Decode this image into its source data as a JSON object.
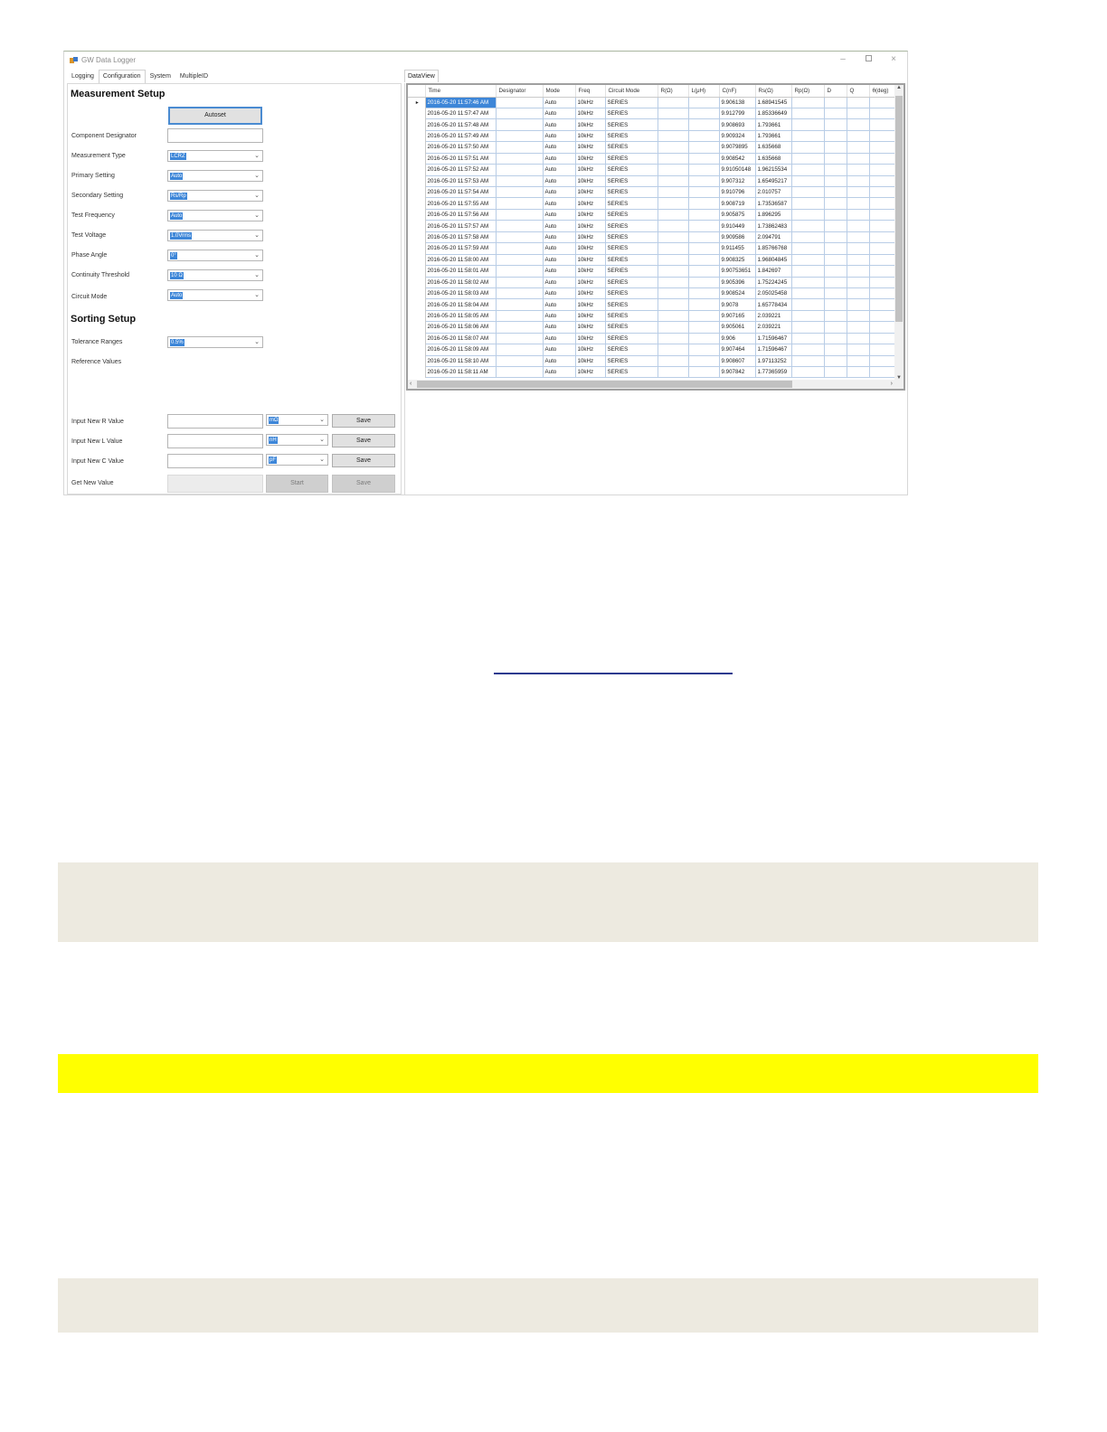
{
  "window": {
    "title": "GW Data Logger",
    "controls": [
      "–",
      "×"
    ]
  },
  "left_tabs": [
    "Logging",
    "Configuration",
    "System",
    "MultipleID"
  ],
  "active_tab": "Configuration",
  "measurement_setup": {
    "title": "Measurement Setup",
    "autoset_label": "Autoset",
    "labels": {
      "component_designator": "Component Designator",
      "measurement_type": "Measurement Type",
      "primary_setting": "Primary Setting",
      "secondary_setting": "Secondary Setting",
      "test_frequency": "Test Frequency",
      "test_voltage": "Test Voltage",
      "phase_angle": "Phase Angle",
      "continuity_threshold": "Continuity Threshold",
      "circuit_mode": "Circuit Mode"
    },
    "values": {
      "measurement_type": "LCRZ",
      "primary_setting": "Auto",
      "secondary_setting": "Rs/Rp",
      "test_frequency": "Auto",
      "test_voltage": "1.0Vrms",
      "phase_angle": "0°",
      "continuity_threshold": "10 Ω",
      "circuit_mode": "Auto"
    }
  },
  "sorting_setup": {
    "title": "Sorting Setup",
    "tolerance_label": "Tolerance Ranges",
    "tolerance_value": "0.5%",
    "reference_label": "Reference Values",
    "input_r_label": "Input New R Value",
    "input_l_label": "Input New L Value",
    "input_c_label": "Input New C Value",
    "get_new_label": "Get New Value",
    "r_unit": "mΩ",
    "l_unit": "nH",
    "c_unit": "pF",
    "save_label": "Save",
    "start_label": "Start"
  },
  "data_view": {
    "tab_label": "DataView",
    "columns": [
      "Time",
      "Designator",
      "Mode",
      "Freq",
      "Circuit Mode",
      "R(Ω)",
      "L(μH)",
      "C(nF)",
      "Rs(Ω)",
      "Rp(Ω)",
      "D",
      "Q",
      "θ(deg)"
    ],
    "rows": [
      [
        "2016-05-20 11:57:46 AM",
        "",
        "Auto",
        "10kHz",
        "SERIES",
        "",
        "",
        "9.906138",
        "1.68941545",
        "",
        "",
        "",
        ""
      ],
      [
        "2016-05-20 11:57:47 AM",
        "",
        "Auto",
        "10kHz",
        "SERIES",
        "",
        "",
        "9.912799",
        "1.85336649",
        "",
        "",
        "",
        ""
      ],
      [
        "2016-05-20 11:57:48 AM",
        "",
        "Auto",
        "10kHz",
        "SERIES",
        "",
        "",
        "9.908693",
        "1.793661",
        "",
        "",
        "",
        ""
      ],
      [
        "2016-05-20 11:57:49 AM",
        "",
        "Auto",
        "10kHz",
        "SERIES",
        "",
        "",
        "9.909324",
        "1.793661",
        "",
        "",
        "",
        ""
      ],
      [
        "2016-05-20 11:57:50 AM",
        "",
        "Auto",
        "10kHz",
        "SERIES",
        "",
        "",
        "9.9079895",
        "1.635668",
        "",
        "",
        "",
        ""
      ],
      [
        "2016-05-20 11:57:51 AM",
        "",
        "Auto",
        "10kHz",
        "SERIES",
        "",
        "",
        "9.908542",
        "1.635668",
        "",
        "",
        "",
        ""
      ],
      [
        "2016-05-20 11:57:52 AM",
        "",
        "Auto",
        "10kHz",
        "SERIES",
        "",
        "",
        "9.91050148",
        "1.96215534",
        "",
        "",
        "",
        ""
      ],
      [
        "2016-05-20 11:57:53 AM",
        "",
        "Auto",
        "10kHz",
        "SERIES",
        "",
        "",
        "9.907312",
        "1.65495217",
        "",
        "",
        "",
        ""
      ],
      [
        "2016-05-20 11:57:54 AM",
        "",
        "Auto",
        "10kHz",
        "SERIES",
        "",
        "",
        "9.910796",
        "2.010757",
        "",
        "",
        "",
        ""
      ],
      [
        "2016-05-20 11:57:55 AM",
        "",
        "Auto",
        "10kHz",
        "SERIES",
        "",
        "",
        "9.908719",
        "1.73536587",
        "",
        "",
        "",
        ""
      ],
      [
        "2016-05-20 11:57:56 AM",
        "",
        "Auto",
        "10kHz",
        "SERIES",
        "",
        "",
        "9.905875",
        "1.896295",
        "",
        "",
        "",
        ""
      ],
      [
        "2016-05-20 11:57:57 AM",
        "",
        "Auto",
        "10kHz",
        "SERIES",
        "",
        "",
        "9.910449",
        "1.73862483",
        "",
        "",
        "",
        ""
      ],
      [
        "2016-05-20 11:57:58 AM",
        "",
        "Auto",
        "10kHz",
        "SERIES",
        "",
        "",
        "9.909586",
        "2.094791",
        "",
        "",
        "",
        ""
      ],
      [
        "2016-05-20 11:57:59 AM",
        "",
        "Auto",
        "10kHz",
        "SERIES",
        "",
        "",
        "9.911455",
        "1.85766768",
        "",
        "",
        "",
        ""
      ],
      [
        "2016-05-20 11:58:00 AM",
        "",
        "Auto",
        "10kHz",
        "SERIES",
        "",
        "",
        "9.908325",
        "1.96804845",
        "",
        "",
        "",
        ""
      ],
      [
        "2016-05-20 11:58:01 AM",
        "",
        "Auto",
        "10kHz",
        "SERIES",
        "",
        "",
        "9.90753651",
        "1.842697",
        "",
        "",
        "",
        ""
      ],
      [
        "2016-05-20 11:58:02 AM",
        "",
        "Auto",
        "10kHz",
        "SERIES",
        "",
        "",
        "9.905396",
        "1.75224245",
        "",
        "",
        "",
        ""
      ],
      [
        "2016-05-20 11:58:03 AM",
        "",
        "Auto",
        "10kHz",
        "SERIES",
        "",
        "",
        "9.908524",
        "2.05025458",
        "",
        "",
        "",
        ""
      ],
      [
        "2016-05-20 11:58:04 AM",
        "",
        "Auto",
        "10kHz",
        "SERIES",
        "",
        "",
        "9.9078",
        "1.65778434",
        "",
        "",
        "",
        ""
      ],
      [
        "2016-05-20 11:58:05 AM",
        "",
        "Auto",
        "10kHz",
        "SERIES",
        "",
        "",
        "9.907165",
        "2.039221",
        "",
        "",
        "",
        ""
      ],
      [
        "2016-05-20 11:58:06 AM",
        "",
        "Auto",
        "10kHz",
        "SERIES",
        "",
        "",
        "9.905061",
        "2.039221",
        "",
        "",
        "",
        ""
      ],
      [
        "2016-05-20 11:58:07 AM",
        "",
        "Auto",
        "10kHz",
        "SERIES",
        "",
        "",
        "9.906",
        "1.71596467",
        "",
        "",
        "",
        ""
      ],
      [
        "2016-05-20 11:58:09 AM",
        "",
        "Auto",
        "10kHz",
        "SERIES",
        "",
        "",
        "9.907464",
        "1.71596467",
        "",
        "",
        "",
        ""
      ],
      [
        "2016-05-20 11:58:10 AM",
        "",
        "Auto",
        "10kHz",
        "SERIES",
        "",
        "",
        "9.908607",
        "1.97113252",
        "",
        "",
        "",
        ""
      ],
      [
        "2016-05-20 11:58:11 AM",
        "",
        "Auto",
        "10kHz",
        "SERIES",
        "",
        "",
        "9.907842",
        "1.77365959",
        "",
        "",
        "",
        ""
      ]
    ],
    "row_indicator": "▸"
  },
  "colors": {
    "selection": "#3d86d8",
    "highlight_band": "#ffff00",
    "note_band": "#edeae0",
    "link_line": "#2b3a8f"
  }
}
